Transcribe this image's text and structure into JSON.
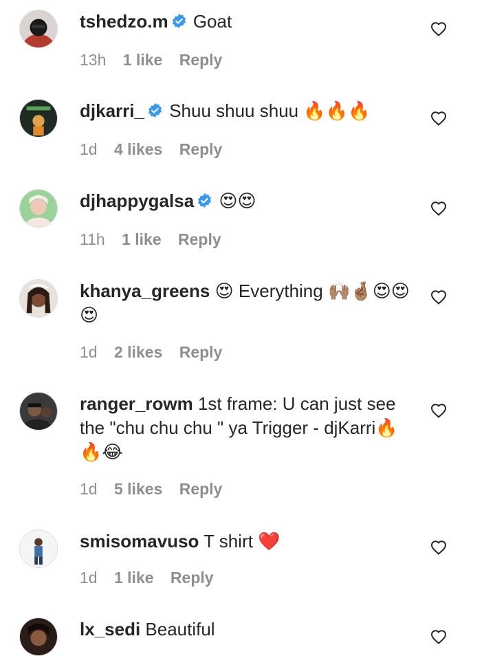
{
  "comments": [
    {
      "username": "tshedzo.m",
      "verified": true,
      "text": "Goat",
      "time": "13h",
      "likes": "1 like",
      "reply": "Reply",
      "avatar_icon": "avatar-tshedzo-icon"
    },
    {
      "username": "djkarri_",
      "verified": true,
      "text": "Shuu shuu shuu 🔥🔥🔥",
      "time": "1d",
      "likes": "4 likes",
      "reply": "Reply",
      "avatar_icon": "avatar-djkarri-icon"
    },
    {
      "username": "djhappygalsa",
      "verified": true,
      "text": "😍😍",
      "time": "11h",
      "likes": "1 like",
      "reply": "Reply",
      "avatar_icon": "avatar-djhappygalsa-icon"
    },
    {
      "username": "khanya_greens",
      "verified": false,
      "text": "😍 Everything 🙌🏽🤞🏽😍😍😍",
      "time": "1d",
      "likes": "2 likes",
      "reply": "Reply",
      "avatar_icon": "avatar-khanya-icon"
    },
    {
      "username": "ranger_rowm",
      "verified": false,
      "text": "1st frame: U can just see the \"chu chu chu \" ya Trigger - djKarri🔥🔥😂",
      "time": "1d",
      "likes": "5 likes",
      "reply": "Reply",
      "avatar_icon": "avatar-ranger-icon"
    },
    {
      "username": "smisomavuso",
      "verified": false,
      "text": "T shirt ❤️",
      "time": "1d",
      "likes": "1 like",
      "reply": "Reply",
      "avatar_icon": "avatar-smiso-icon"
    },
    {
      "username": "lx_sedi",
      "verified": false,
      "text": "Beautiful",
      "avatar_icon": "avatar-lxsedi-icon"
    }
  ],
  "colors": {
    "verified_badge": "#3897f0",
    "meta_text": "#8e8e8e",
    "primary_text": "#262626"
  }
}
